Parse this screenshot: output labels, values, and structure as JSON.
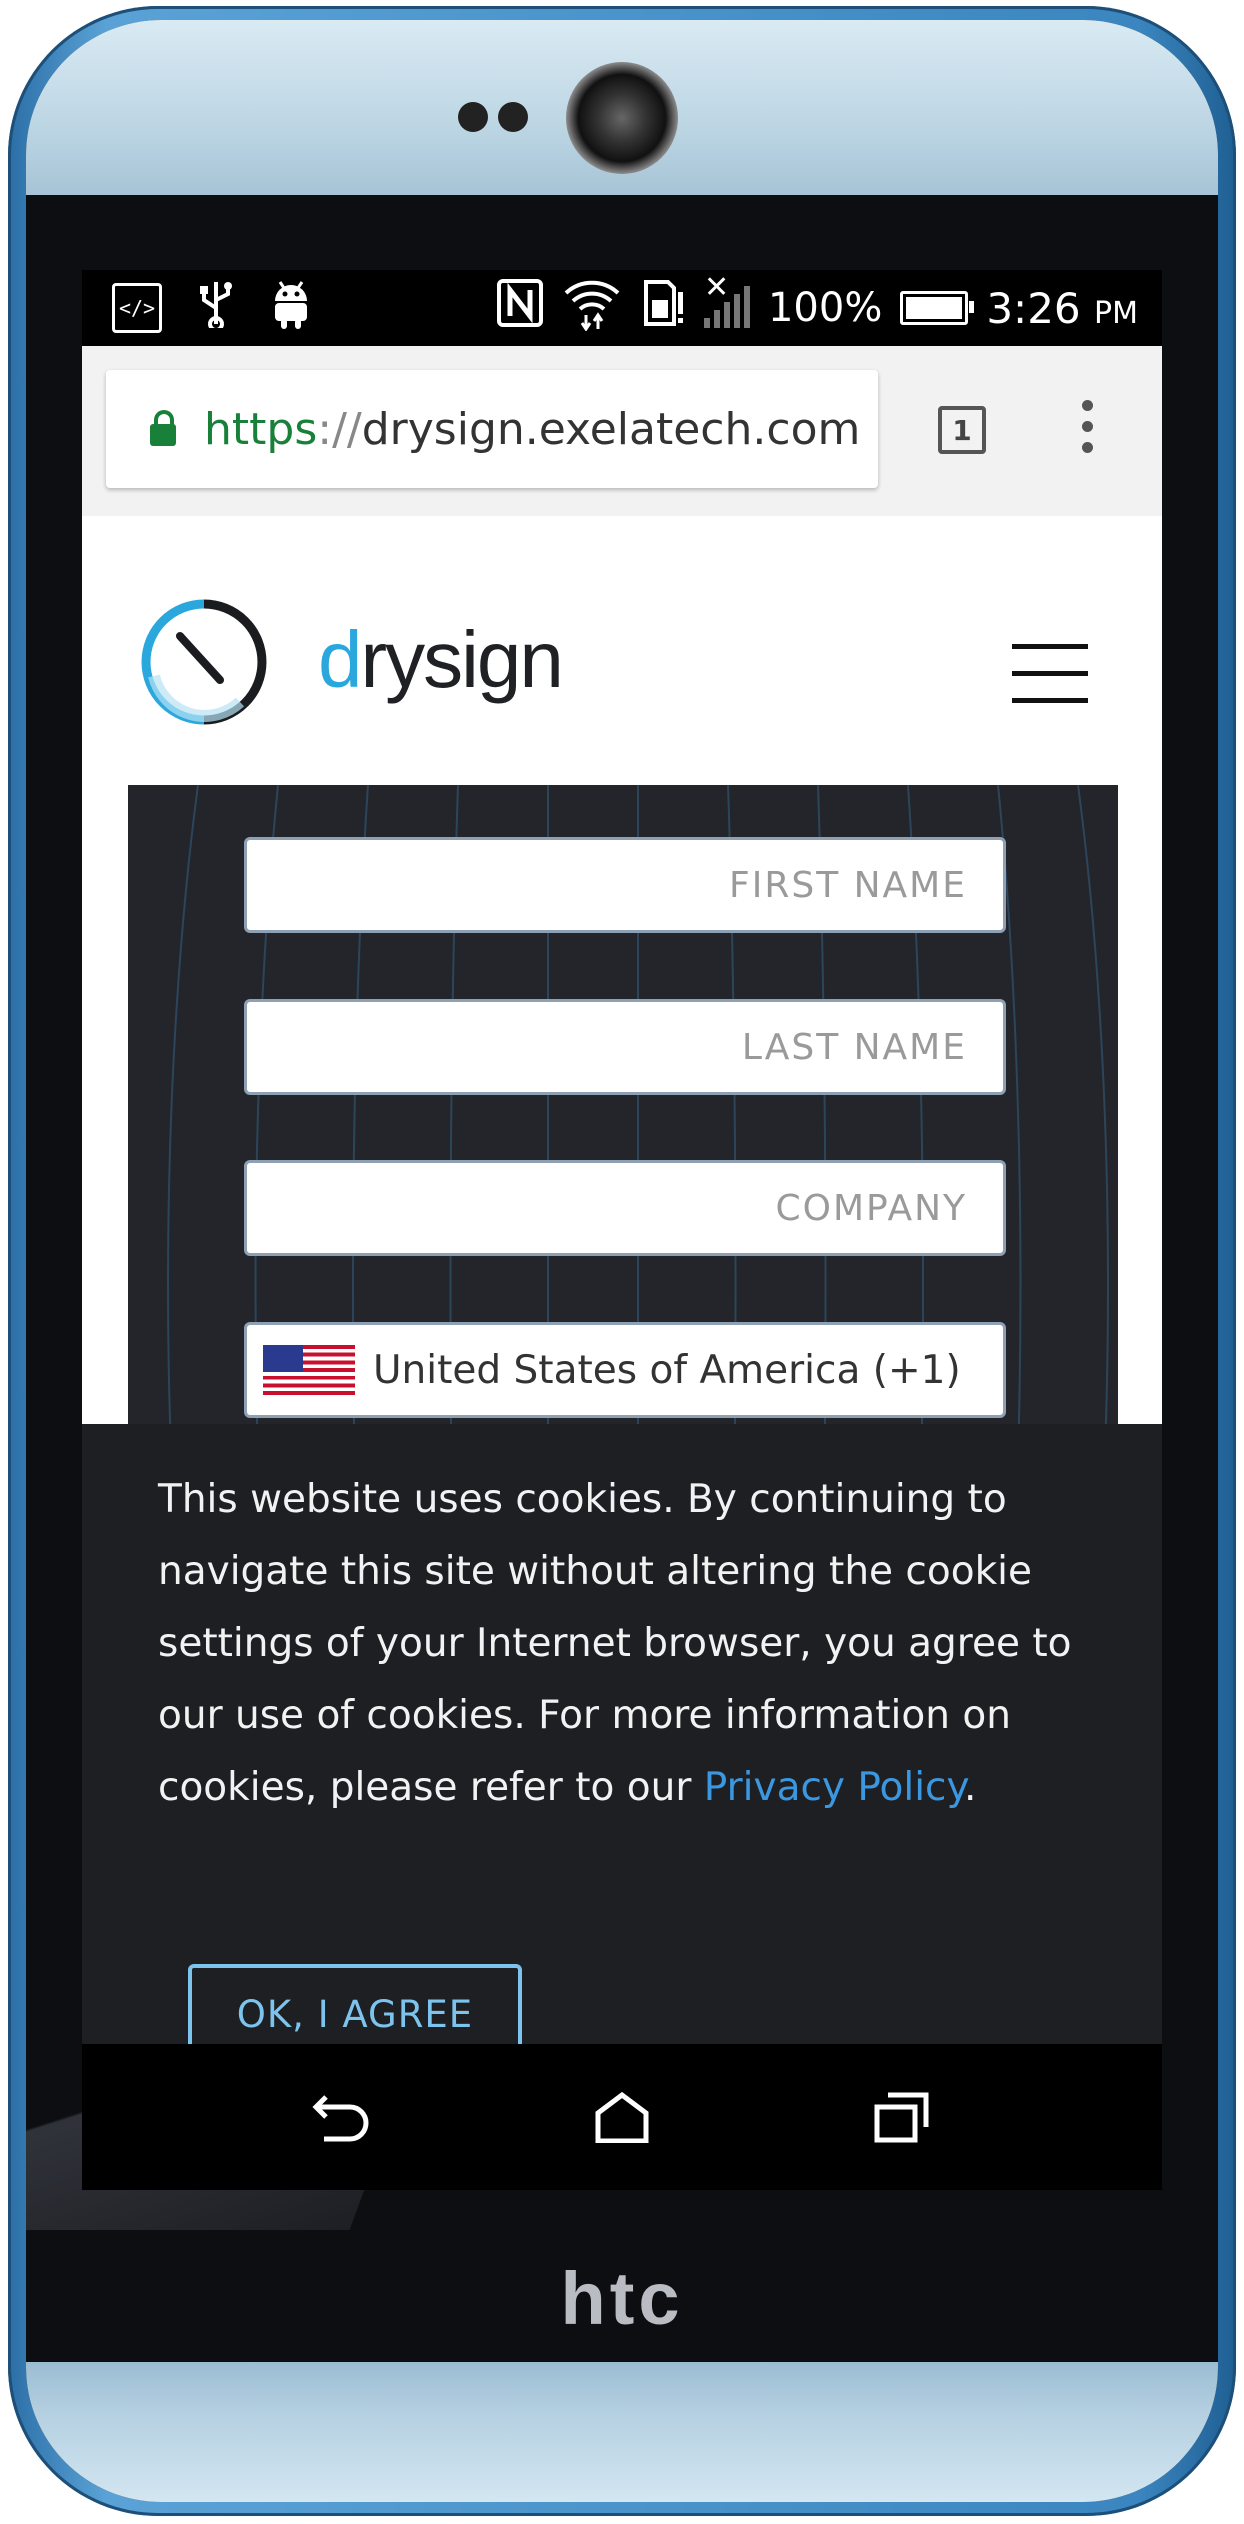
{
  "device": {
    "brand": "htc"
  },
  "status_bar": {
    "battery": "100%",
    "time": "3:26",
    "ampm": "PM",
    "left_icons": [
      "code-icon",
      "usb-icon",
      "android-icon"
    ],
    "right_icons": [
      "nfc-icon",
      "wifi-icon",
      "sd-card-icon",
      "no-signal-icon",
      "battery-icon"
    ]
  },
  "browser": {
    "url_scheme": "https",
    "url_sep": "://",
    "url_host": "drysign.exelatech.com",
    "tab_count": "1"
  },
  "site": {
    "logo_d": "d",
    "logo_rest": "rysign",
    "accent_color": "#2aa7dd"
  },
  "form": {
    "first_name_placeholder": "FIRST NAME",
    "last_name_placeholder": "LAST NAME",
    "company_placeholder": "COMPANY",
    "country_value": "United States of America (+1)"
  },
  "cookie_banner": {
    "text": "This website uses cookies. By continuing to navigate this site without altering the cookie settings of your Internet browser, you agree to our use of cookies. For more information on cookies, please refer to our ",
    "link": "Privacy Policy",
    "suffix": ".",
    "button": "OK, I AGREE",
    "link_color": "#3a97e0"
  }
}
